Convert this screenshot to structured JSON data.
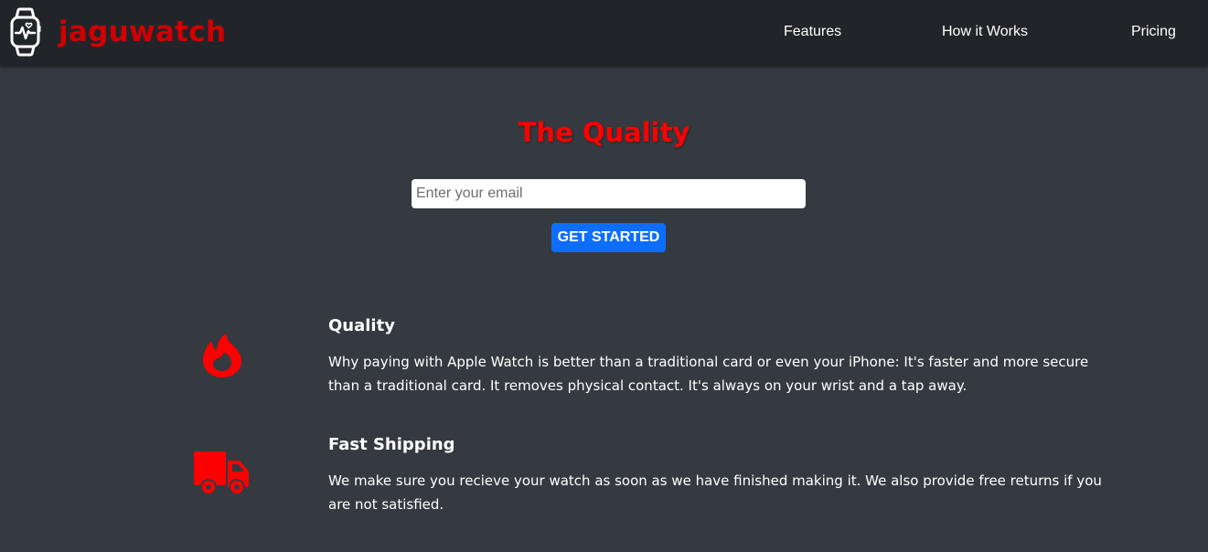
{
  "navbar": {
    "logo_icon": "smartwatch-heartbeat-icon",
    "brand_name": "jaguwatch",
    "links": [
      {
        "label": "Features"
      },
      {
        "label": "How it Works"
      },
      {
        "label": "Pricing"
      }
    ]
  },
  "hero": {
    "title": "The Quality",
    "email_placeholder": "Enter your email",
    "email_value": "",
    "cta_label": "Get Started"
  },
  "features": [
    {
      "icon": "fire-icon",
      "title": "Quality",
      "text": "Why paying with Apple Watch is better than a traditional card or even your iPhone: It's faster and more secure than a traditional card. It removes physical contact. It's always on your wrist and a tap away."
    },
    {
      "icon": "truck-icon",
      "title": "Fast Shipping",
      "text": "We make sure you recieve your watch as soon as we have finished making it. We also provide free returns if you are not satisfied."
    }
  ],
  "colors": {
    "page_background": "#343a40",
    "navbar_background": "#212529",
    "brand_red": "#d00000",
    "title_red": "#ff0000",
    "button_blue": "#0d6efd",
    "text": "#ffffff"
  }
}
